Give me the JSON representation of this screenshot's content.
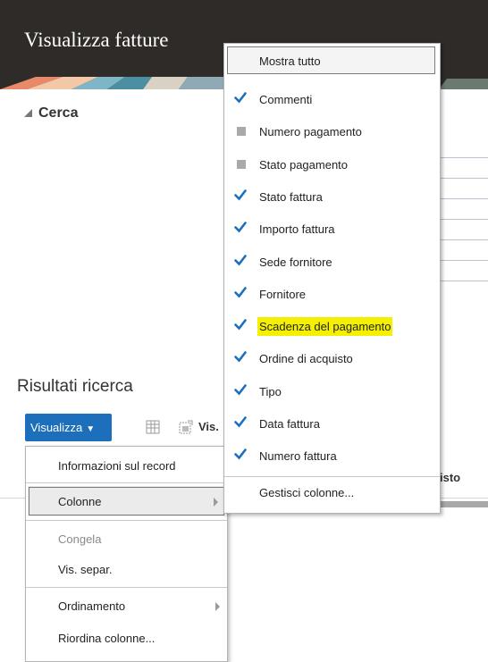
{
  "header": {
    "title": "Visualizza fatture"
  },
  "search": {
    "label": "Cerca"
  },
  "results": {
    "title": "Risultati ricerca",
    "view_button": "Visualizza",
    "view_truncated": "Vis.",
    "column_partial": "isto"
  },
  "view_menu": {
    "items": [
      {
        "label": "Informazioni sul record"
      },
      {
        "label": "Colonne"
      },
      {
        "label": "Congela"
      },
      {
        "label": "Vis. separ."
      },
      {
        "label": "Ordinamento"
      },
      {
        "label": "Riordina colonne..."
      }
    ]
  },
  "columns_menu": {
    "show_all": "Mostra tutto",
    "items": [
      {
        "label": "Commenti",
        "checked": true
      },
      {
        "label": "Numero pagamento",
        "checked": false
      },
      {
        "label": "Stato pagamento",
        "checked": false
      },
      {
        "label": "Stato fattura",
        "checked": true
      },
      {
        "label": "Importo fattura",
        "checked": true
      },
      {
        "label": "Sede fornitore",
        "checked": true
      },
      {
        "label": "Fornitore",
        "checked": true
      },
      {
        "label": "Scadenza del pagamento",
        "checked": true,
        "highlighted": true
      },
      {
        "label": "Ordine di acquisto",
        "checked": true
      },
      {
        "label": "Tipo",
        "checked": true
      },
      {
        "label": "Data fattura",
        "checked": true
      },
      {
        "label": "Numero fattura",
        "checked": true
      }
    ],
    "manage": "Gestisci colonne..."
  },
  "colors": {
    "accent": "#1e6fbb",
    "check": "#1e6fbb",
    "highlight": "#f4f000",
    "header_bg": "#2f2b28"
  }
}
